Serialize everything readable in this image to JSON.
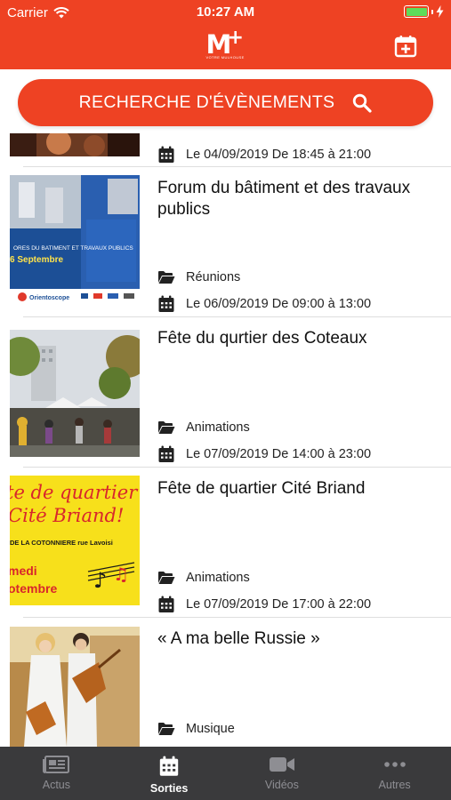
{
  "status_bar": {
    "carrier": "Carrier",
    "time": "10:27 AM"
  },
  "header": {
    "logo_text": "M",
    "logo_plus": "+",
    "logo_sub": "VOTRE MULHOUSE"
  },
  "search": {
    "label": "RECHERCHE D'ÉVÈNEMENTS"
  },
  "events": [
    {
      "title": "",
      "category": "",
      "date": "Le 04/09/2019 De 18:45 à 21:00"
    },
    {
      "title": "Forum du bâtiment et des travaux publics",
      "category": "Réunions",
      "date": "Le 06/09/2019 De 09:00 à 13:00"
    },
    {
      "title": "Fête du qurtier des Coteaux",
      "category": "Animations",
      "date": "Le 07/09/2019 De 14:00 à 23:00"
    },
    {
      "title": "Fête de quartier Cité Briand",
      "category": "Animations",
      "date": "Le 07/09/2019 De 17:00 à 22:00"
    },
    {
      "title": "« A ma belle Russie »",
      "category": "Musique",
      "date": ""
    }
  ],
  "poster_texts": {
    "forum_left": "ORES DU BATIMENT ET TRAVAUX PUBLICS",
    "forum_day": "6 Septembre",
    "forum_brand": "Orientoscope",
    "briand_line1": "te de quartier",
    "briand_line2": "Cité Briand!",
    "briand_line3": "DE LA COTONNIERE rue Lavoisi",
    "briand_line4": "medi",
    "briand_line5": "otembre"
  },
  "tabs": [
    {
      "label": "Actus",
      "icon": "newspaper-icon"
    },
    {
      "label": "Sorties",
      "icon": "calendar-icon"
    },
    {
      "label": "Vidéos",
      "icon": "video-camera-icon"
    },
    {
      "label": "Autres",
      "icon": "more-dots-icon"
    }
  ],
  "colors": {
    "brand": "#ee4223",
    "tabbar": "#3a3a3c",
    "tab_inactive": "#8e8e93",
    "poster_yellow": "#f7e01b"
  }
}
